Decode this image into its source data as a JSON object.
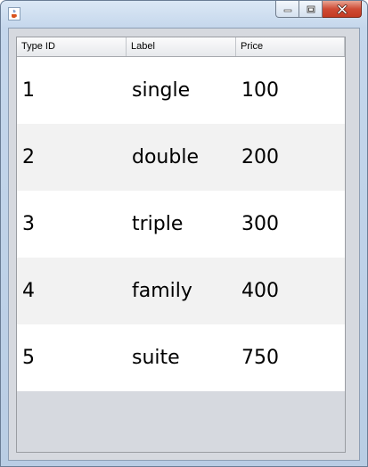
{
  "window": {
    "title": "",
    "app_icon": "java-cup-icon",
    "controls": [
      "minimize-icon",
      "maximize-icon",
      "close-icon"
    ],
    "colors": {
      "close_button": "#c8442c",
      "frame": "#c5d7ec",
      "client": "#d6d9df"
    }
  },
  "table": {
    "columns": [
      "Type ID",
      "Label",
      "Price"
    ],
    "rows": [
      [
        "1",
        "single",
        "100"
      ],
      [
        "2",
        "double",
        "200"
      ],
      [
        "3",
        "triple",
        "300"
      ],
      [
        "4",
        "family",
        "400"
      ],
      [
        "5",
        "suite",
        "750"
      ]
    ],
    "colors": {
      "row_even": "#ffffff",
      "row_odd": "#f2f2f2"
    }
  }
}
